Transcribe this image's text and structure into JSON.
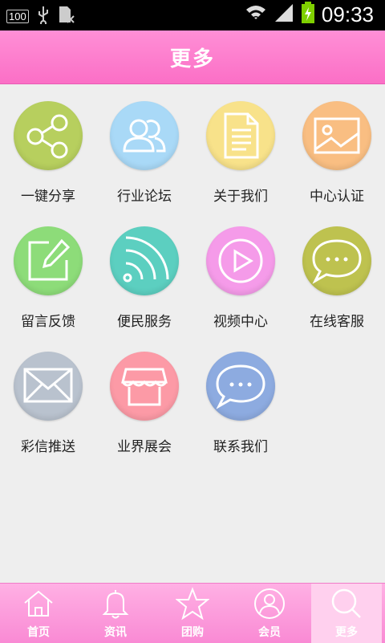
{
  "status_bar": {
    "battery_level": "100",
    "time": "09:33"
  },
  "header": {
    "title": "更多"
  },
  "grid": {
    "items": [
      {
        "label": "一键分享",
        "icon": "share-icon",
        "color": "#b7cf5e"
      },
      {
        "label": "行业论坛",
        "icon": "users-icon",
        "color": "#a9d9f7"
      },
      {
        "label": "关于我们",
        "icon": "document-icon",
        "color": "#f8e28a"
      },
      {
        "label": "中心认证",
        "icon": "image-icon",
        "color": "#f9be82"
      },
      {
        "label": "留言反馈",
        "icon": "edit-icon",
        "color": "#8ddc79"
      },
      {
        "label": "便民服务",
        "icon": "rss-icon",
        "color": "#5ccfc0"
      },
      {
        "label": "视频中心",
        "icon": "play-icon",
        "color": "#f59be9"
      },
      {
        "label": "在线客服",
        "icon": "chat-icon",
        "color": "#bec24f"
      },
      {
        "label": "彩信推送",
        "icon": "mail-icon",
        "color": "#b9c2ce"
      },
      {
        "label": "业界展会",
        "icon": "store-icon",
        "color": "#fc9aa6"
      },
      {
        "label": "联系我们",
        "icon": "chat-icon",
        "color": "#8dabe0"
      }
    ]
  },
  "tabbar": {
    "items": [
      {
        "label": "首页",
        "icon": "home-icon"
      },
      {
        "label": "资讯",
        "icon": "bell-icon"
      },
      {
        "label": "团购",
        "icon": "star-icon"
      },
      {
        "label": "会员",
        "icon": "user-icon"
      },
      {
        "label": "更多",
        "icon": "search-icon",
        "active": true
      }
    ]
  }
}
